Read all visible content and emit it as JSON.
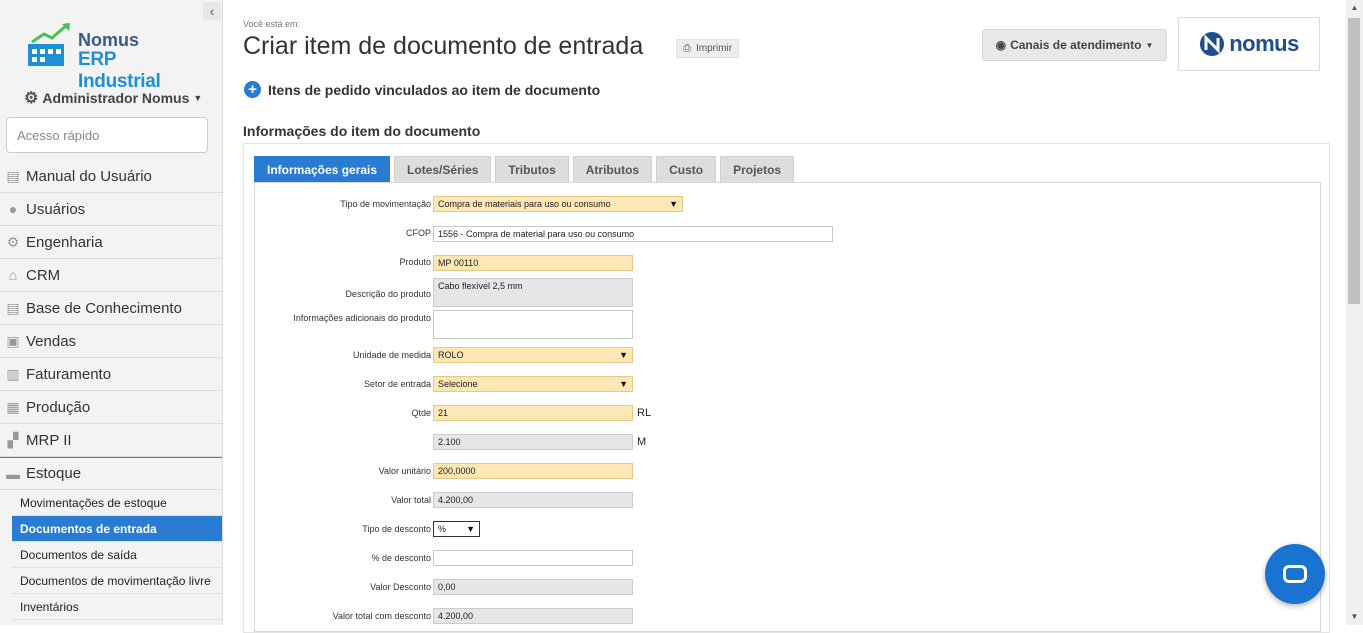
{
  "sidebar": {
    "logo": {
      "line1": "Nomus",
      "line2": "ERP Industrial"
    },
    "user": "Administrador Nomus",
    "quick_access_placeholder": "Acesso rápido",
    "nav": [
      {
        "label": "Manual do Usuário",
        "icon": "book-icon"
      },
      {
        "label": "Usuários",
        "icon": "user-icon"
      },
      {
        "label": "Engenharia",
        "icon": "gear-icon"
      },
      {
        "label": "CRM",
        "icon": "home-icon"
      },
      {
        "label": "Base de Conhecimento",
        "icon": "book-icon"
      },
      {
        "label": "Vendas",
        "icon": "briefcase-icon"
      },
      {
        "label": "Faturamento",
        "icon": "invoice-icon"
      },
      {
        "label": "Produção",
        "icon": "factory-icon"
      },
      {
        "label": "MRP II",
        "icon": "boxes-icon"
      }
    ],
    "active_group": {
      "label": "Estoque",
      "icon": "folder-icon"
    },
    "sub_items": [
      "Movimentações de estoque",
      "Documentos de entrada",
      "Documentos de saída",
      "Documentos de movimentação livre",
      "Inventários"
    ]
  },
  "header": {
    "breadcrumb": "Você está em:",
    "title": "Criar item de documento de entrada",
    "print_label": "Imprimir",
    "channels_label": "Canais de atendimento",
    "brand": "nomus"
  },
  "linked_orders": "Itens de pedido vinculados ao item de documento",
  "section_title": "Informações do item do documento",
  "tabs": [
    "Informações gerais",
    "Lotes/Séries",
    "Tributos",
    "Atributos",
    "Custo",
    "Projetos"
  ],
  "form": {
    "tipo_movimentacao": {
      "label": "Tipo de movimentação",
      "value": "Compra de materiais para uso ou consumo"
    },
    "cfop": {
      "label": "CFOP",
      "value": "1556 - Compra de material para uso ou consumo"
    },
    "produto": {
      "label": "Produto",
      "value": "MP 00110"
    },
    "descricao": {
      "label": "Descrição do produto",
      "value": "Cabo flexível 2,5 mm"
    },
    "info_adicionais": {
      "label": "Informações adicionais do produto",
      "value": ""
    },
    "unidade": {
      "label": "Unidade de medida",
      "value": "ROLO"
    },
    "setor": {
      "label": "Setor de entrada",
      "value": "Selecione"
    },
    "qtde": {
      "label": "Qtde",
      "value": "21",
      "unit": "RL"
    },
    "qtde2": {
      "value": "2.100",
      "unit": "M"
    },
    "valor_unitario": {
      "label": "Valor unitário",
      "value": "200,0000"
    },
    "valor_total": {
      "label": "Valor total",
      "value": "4.200,00"
    },
    "tipo_desconto": {
      "label": "Tipo de desconto",
      "value": "%"
    },
    "perc_desconto": {
      "label": "% de desconto",
      "value": ""
    },
    "valor_desconto": {
      "label": "Valor Desconto",
      "value": "0,00"
    },
    "valor_total_desc": {
      "label": "Valor total com desconto",
      "value": "4.200,00"
    }
  },
  "colors": {
    "accent": "#2a7bd2",
    "required_field": "#fde7b5",
    "readonly_field": "#e6e6e6"
  }
}
